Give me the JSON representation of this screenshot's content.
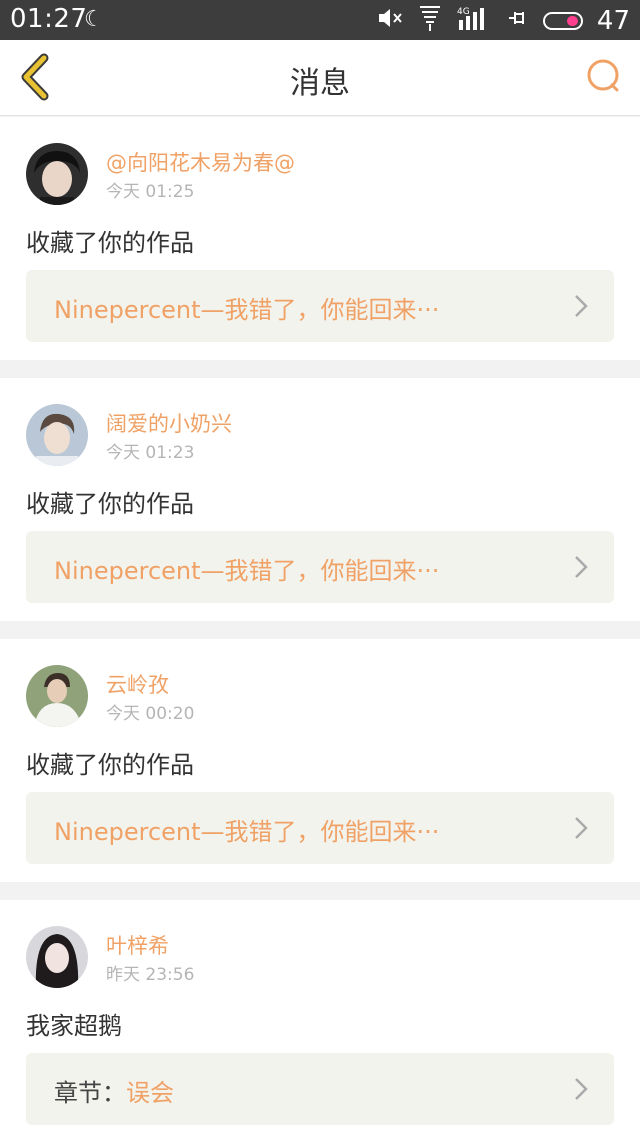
{
  "status_bar": {
    "time": "01:27",
    "battery": "47"
  },
  "header": {
    "title": "消息"
  },
  "messages": [
    {
      "user": "@向阳花木易为春@",
      "time": "今天  01:25",
      "action": "收藏了你的作品",
      "work_label": "",
      "work_title": "Ninepercent—我错了，你能回来···"
    },
    {
      "user": "阔爱的小奶兴",
      "time": "今天  01:23",
      "action": "收藏了你的作品",
      "work_label": "",
      "work_title": "Ninepercent—我错了，你能回来···"
    },
    {
      "user": "云岭孜",
      "time": "今天  00:20",
      "action": "收藏了你的作品",
      "work_label": "",
      "work_title": "Ninepercent—我错了，你能回来···"
    },
    {
      "user": "叶梓希",
      "time": "昨天  23:56",
      "action": "我家超鹅",
      "work_label": "章节：",
      "work_title": "误会"
    }
  ],
  "colors": {
    "accent": "#f0a266",
    "back_arrow": "#e8c233",
    "work_bg": "#f3f3ee",
    "status_bg": "#3d3d3d"
  }
}
